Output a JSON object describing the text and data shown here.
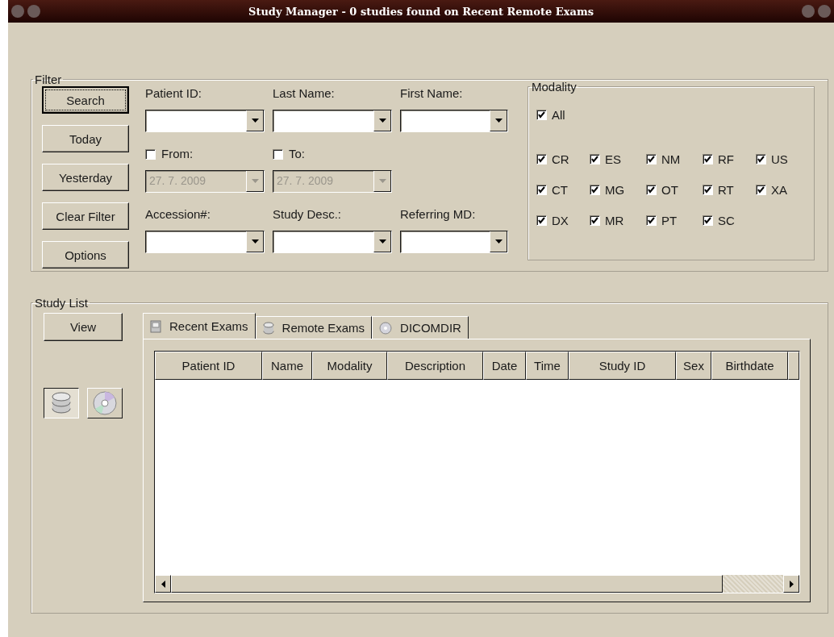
{
  "window": {
    "title": "Study Manager - 0 studies found on Recent Remote Exams"
  },
  "filter": {
    "label": "Filter",
    "buttons": [
      {
        "label": "Search",
        "focused": true
      },
      {
        "label": "Today",
        "focused": false
      },
      {
        "label": "Yesterday",
        "focused": false
      },
      {
        "label": "Clear Filter",
        "focused": false
      },
      {
        "label": "Options",
        "focused": false
      }
    ],
    "field_rows": [
      [
        {
          "kind": "combo",
          "label": "Patient ID:"
        },
        {
          "kind": "combo",
          "label": "Last Name:"
        },
        {
          "kind": "combo",
          "label": "First Name:"
        }
      ],
      [
        {
          "kind": "date",
          "label": "From:",
          "checked": false,
          "value": "27. 7. 2009",
          "disabled": true
        },
        {
          "kind": "date",
          "label": "To:",
          "checked": false,
          "value": "27. 7. 2009",
          "disabled": true
        }
      ],
      [
        {
          "kind": "combo",
          "label": "Accession#:"
        },
        {
          "kind": "combo",
          "label": "Study Desc.:"
        },
        {
          "kind": "combo",
          "label": "Referring MD:"
        }
      ]
    ],
    "modality": {
      "label": "Modality",
      "all": {
        "label": "All",
        "checked": true
      },
      "items": [
        {
          "label": "CR",
          "checked": true
        },
        {
          "label": "ES",
          "checked": true
        },
        {
          "label": "NM",
          "checked": true
        },
        {
          "label": "RF",
          "checked": true
        },
        {
          "label": "US",
          "checked": true
        },
        {
          "label": "CT",
          "checked": true
        },
        {
          "label": "MG",
          "checked": true
        },
        {
          "label": "OT",
          "checked": true
        },
        {
          "label": "RT",
          "checked": true
        },
        {
          "label": "XA",
          "checked": true
        },
        {
          "label": "DX",
          "checked": true
        },
        {
          "label": "MR",
          "checked": true
        },
        {
          "label": "PT",
          "checked": true
        },
        {
          "label": "SC",
          "checked": true
        }
      ]
    }
  },
  "study_list": {
    "label": "Study List",
    "view_button": "View",
    "sources": [
      {
        "kind": "database",
        "selected": true
      },
      {
        "kind": "disc",
        "selected": false
      }
    ],
    "tabs": [
      {
        "kind": "drive",
        "label": "Recent Exams",
        "selected": true
      },
      {
        "kind": "database",
        "label": "Remote Exams",
        "selected": false
      },
      {
        "kind": "disc",
        "label": "DICOMDIR",
        "selected": false
      }
    ],
    "table": {
      "columns": [
        "Patient ID",
        "Name",
        "Modality",
        "Description",
        "Date",
        "Time",
        "Study ID",
        "Sex",
        "Birthdate"
      ]
    }
  }
}
